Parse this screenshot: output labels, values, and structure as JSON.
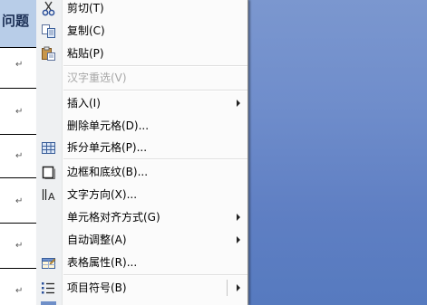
{
  "document": {
    "header_text": "问题",
    "paragraph_mark": "↵"
  },
  "menu": {
    "items": [
      {
        "label": "剪切(T)",
        "icon": "scissors-icon",
        "disabled": false,
        "submenu": false
      },
      {
        "label": "复制(C)",
        "icon": "copy-icon",
        "disabled": false,
        "submenu": false
      },
      {
        "label": "粘贴(P)",
        "icon": "paste-icon",
        "disabled": false,
        "submenu": false
      },
      {
        "label": "汉字重选(V)",
        "icon": "",
        "disabled": true,
        "submenu": false
      },
      {
        "label": "插入(I)",
        "icon": "",
        "disabled": false,
        "submenu": true
      },
      {
        "label": "删除单元格(D)...",
        "icon": "",
        "disabled": false,
        "submenu": false
      },
      {
        "label": "拆分单元格(P)...",
        "icon": "split-cells-icon",
        "disabled": false,
        "submenu": false
      },
      {
        "label": "边框和底纹(B)...",
        "icon": "borders-shading-icon",
        "disabled": false,
        "submenu": false
      },
      {
        "label": "文字方向(X)...",
        "icon": "text-direction-icon",
        "disabled": false,
        "submenu": false
      },
      {
        "label": "单元格对齐方式(G)",
        "icon": "",
        "disabled": false,
        "submenu": true
      },
      {
        "label": "自动调整(A)",
        "icon": "",
        "disabled": false,
        "submenu": true
      },
      {
        "label": "表格属性(R)...",
        "icon": "table-properties-icon",
        "disabled": false,
        "submenu": false
      },
      {
        "label": "项目符号(B)",
        "icon": "bullets-icon",
        "disabled": false,
        "submenu": true
      }
    ]
  }
}
